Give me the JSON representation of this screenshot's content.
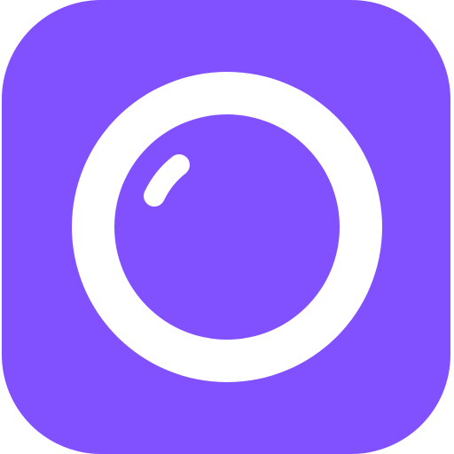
{
  "app_icon": {
    "icon": "camera-lens-icon",
    "colors": {
      "background": "#8150FF",
      "ring": "#FFFFFF",
      "lens": "#8150FF",
      "highlight": "#FFFFFF",
      "page": "#FFFFFF"
    }
  }
}
